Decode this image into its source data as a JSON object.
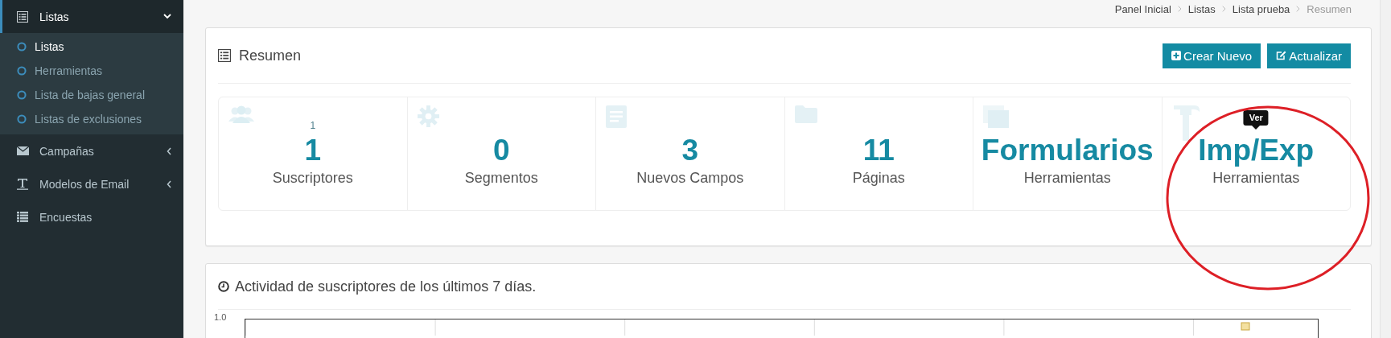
{
  "sidebar": {
    "items": [
      {
        "kind": "menu",
        "label": "Listas",
        "expanded": true,
        "selected": true,
        "children": [
          {
            "label": "Listas",
            "selected": true
          },
          {
            "label": "Herramientas",
            "selected": false
          },
          {
            "label": "Lista de bajas general",
            "selected": false
          },
          {
            "label": "Listas de exclusiones",
            "selected": false
          }
        ]
      },
      {
        "kind": "menu",
        "label": "Campañas",
        "expanded": false,
        "selected": false
      },
      {
        "kind": "menu",
        "label": "Modelos de Email",
        "expanded": false,
        "selected": false
      },
      {
        "kind": "link",
        "label": "Encuestas",
        "selected": false
      }
    ]
  },
  "breadcrumb": [
    {
      "label": "Panel Inicial",
      "current": false
    },
    {
      "label": "Listas",
      "current": false
    },
    {
      "label": "Lista prueba",
      "current": false
    },
    {
      "label": "Resumen",
      "current": true
    }
  ],
  "summary": {
    "title": "Resumen",
    "buttons": [
      {
        "label": "Crear Nuevo"
      },
      {
        "label": "Actualizar"
      }
    ],
    "stats": [
      {
        "count": "1",
        "value": "1",
        "label": "Suscriptores"
      },
      {
        "value": "0",
        "label": "Segmentos"
      },
      {
        "value": "3",
        "label": "Nuevos Campos"
      },
      {
        "value": "11",
        "label": "Páginas"
      },
      {
        "value": "Formularios",
        "label": "Herramientas"
      },
      {
        "value": "Imp/Exp",
        "label": "Herramientas",
        "tooltip": "Ver"
      }
    ]
  },
  "activity": {
    "title": "Actividad de suscriptores de los últimos 7 días.",
    "chart": {
      "y_tick": "1.0"
    }
  },
  "annotation_circle": true
}
